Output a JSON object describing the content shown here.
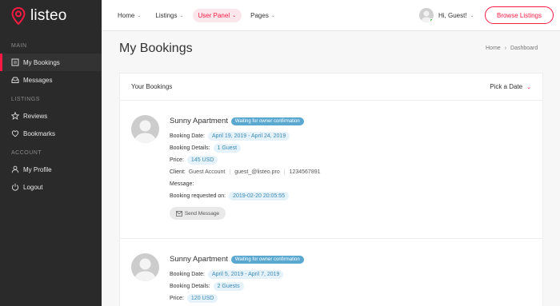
{
  "brand": {
    "name": "listeo",
    "color": "#f91942"
  },
  "header": {
    "nav": [
      {
        "label": "Home"
      },
      {
        "label": "Listings"
      },
      {
        "label": "User Panel"
      },
      {
        "label": "Pages"
      }
    ],
    "greeting": "Hi, Guest!",
    "browse_label": "Browse Listings"
  },
  "sidebar": {
    "main_label": "Main",
    "listings_label": "Listings",
    "account_label": "Account",
    "items": {
      "my_bookings": "My Bookings",
      "messages": "Messages",
      "reviews": "Reviews",
      "bookmarks": "Bookmarks",
      "my_profile": "My Profile",
      "logout": "Logout"
    }
  },
  "page": {
    "title": "My Bookings",
    "breadcrumb": [
      "Home",
      "Dashboard"
    ]
  },
  "panel": {
    "title": "Your Bookings",
    "pick_date": "Pick a Date"
  },
  "labels": {
    "booking_date": "Booking Date:",
    "booking_details": "Booking Details:",
    "price": "Price:",
    "client": "Client:",
    "message": "Message:",
    "requested_on": "Booking requested on:",
    "send_message": "Send Message"
  },
  "bookings": [
    {
      "title": "Sunny Apartment",
      "status": "Waiting for owner confirmation",
      "date": "April 19, 2019 - April 24, 2019",
      "details": "1 Guest",
      "price": "145 USD",
      "client_name": "Guest Account",
      "client_email": "guest_@listeo.pro",
      "client_phone": "1234567891",
      "requested_on": "2019-02-20 20:05:55"
    },
    {
      "title": "Sunny Apartment",
      "status": "Waiting for owner confirmation",
      "date": "April 5, 2019 - April 7, 2019",
      "details": "2 Guests",
      "price": "120 USD"
    }
  ]
}
